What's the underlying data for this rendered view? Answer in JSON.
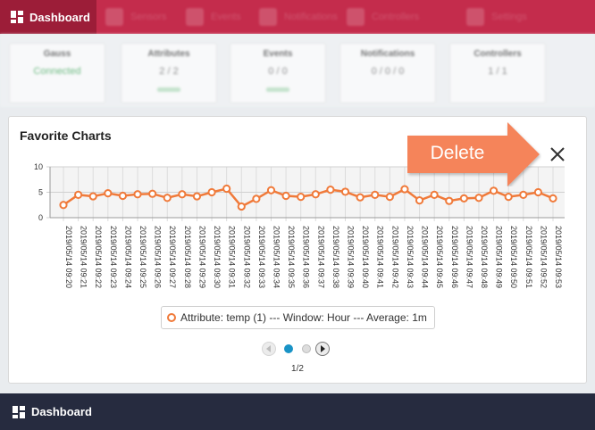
{
  "topnav": {
    "active_label": "Dashboard",
    "items": [
      "Sensors",
      "Events",
      "Notifications",
      "Controllers",
      "Settings"
    ]
  },
  "cards": [
    {
      "title": "Gauss",
      "value": "Connected"
    },
    {
      "title": "Attributes",
      "value": "2 / 2"
    },
    {
      "title": "Events",
      "value": "0 / 0"
    },
    {
      "title": "Notifications",
      "value": "0 / 0 / 0"
    },
    {
      "title": "Controllers",
      "value": "1 / 1"
    }
  ],
  "panel": {
    "title": "Favorite Charts",
    "close_icon": "close-icon"
  },
  "callout": {
    "label": "Delete",
    "color": "#f5845a"
  },
  "chart_data": {
    "type": "line",
    "ylim": [
      0,
      10
    ],
    "yticks": [
      0,
      5,
      10
    ],
    "grid": true,
    "legend_position": "bottom",
    "series": [
      {
        "name": "Attribute: temp (1) --- Window: Hour --- Average: 1m",
        "color": "#f07a3a",
        "values": [
          2.5,
          4.5,
          4.2,
          4.8,
          4.3,
          4.6,
          4.7,
          3.9,
          4.6,
          4.2,
          5.0,
          5.7,
          2.2,
          3.7,
          5.4,
          4.3,
          4.1,
          4.6,
          5.5,
          5.1,
          4.0,
          4.5,
          4.1,
          5.6,
          3.4,
          4.5,
          3.3,
          3.8,
          3.9,
          5.3,
          4.1,
          4.5,
          5.0,
          3.8
        ]
      }
    ],
    "categories": [
      "2019/05/14 09:20",
      "2019/05/14 09:21",
      "2019/05/14 09:22",
      "2019/05/14 09:23",
      "2019/05/14 09:24",
      "2019/05/14 09:25",
      "2019/05/14 09:26",
      "2019/05/14 09:27",
      "2019/05/14 09:28",
      "2019/05/14 09:29",
      "2019/05/14 09:30",
      "2019/05/14 09:31",
      "2019/05/14 09:32",
      "2019/05/14 09:33",
      "2019/05/14 09:34",
      "2019/05/14 09:35",
      "2019/05/14 09:36",
      "2019/05/14 09:37",
      "2019/05/14 09:38",
      "2019/05/14 09:39",
      "2019/05/14 09:40",
      "2019/05/14 09:41",
      "2019/05/14 09:42",
      "2019/05/14 09:43",
      "2019/05/14 09:44",
      "2019/05/14 09:45",
      "2019/05/14 09:46",
      "2019/05/14 09:47",
      "2019/05/14 09:48",
      "2019/05/14 09:49",
      "2019/05/14 09:50",
      "2019/05/14 09:51",
      "2019/05/14 09:52",
      "2019/05/14 09:53"
    ]
  },
  "pager": {
    "indicator": "1/2",
    "current": 1,
    "total": 2,
    "accent": "#1993c6"
  },
  "bottombar": {
    "label": "Dashboard"
  }
}
